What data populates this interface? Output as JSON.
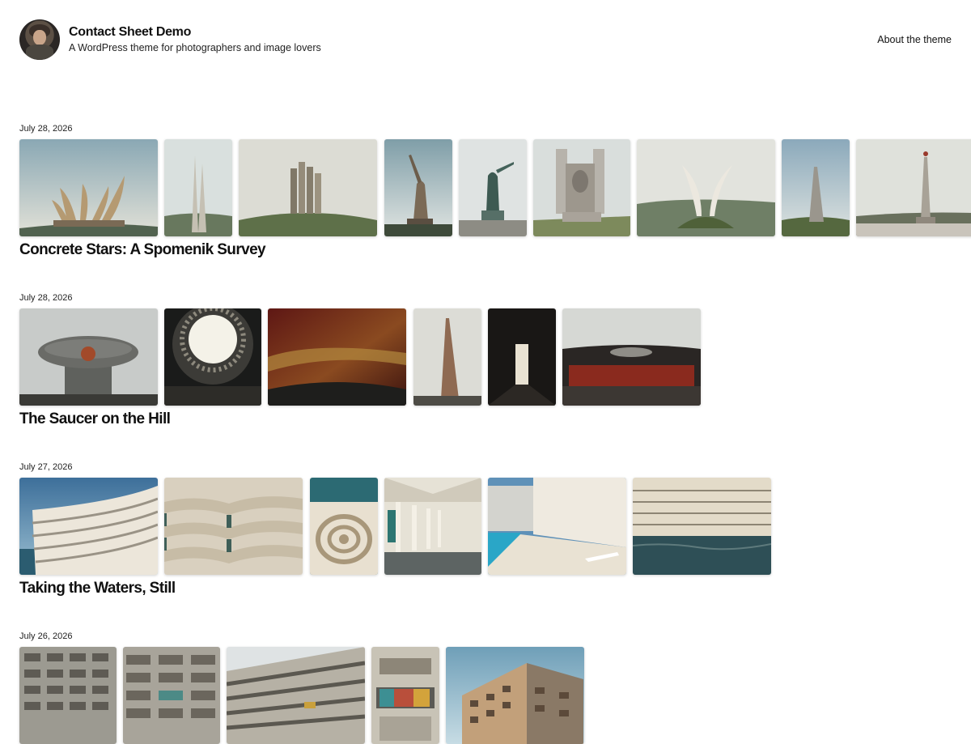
{
  "header": {
    "site_title": "Contact Sheet Demo",
    "tagline": "A WordPress theme for photographers and image lovers",
    "nav": {
      "about_label": "About the theme"
    }
  },
  "posts": [
    {
      "date": "July 28, 2026",
      "title": "Concrete Stars: A Spomenik Survey",
      "photos": [
        "petal-monument-photo",
        "twin-spire-monument-photo",
        "pillar-cluster-monument-photo",
        "sword-statue-photo",
        "soldier-statue-photo",
        "stone-face-monument-photo",
        "horn-monument-photo",
        "needle-spire-photo",
        "obelisk-star-photo"
      ]
    },
    {
      "date": "July 28, 2026",
      "title": "The Saucer on the Hill",
      "photos": [
        "saucer-exterior-photo",
        "dome-oculus-photo",
        "mosaic-ceiling-photo",
        "tower-spike-photo",
        "dark-corridor-photo",
        "ring-hall-mural-photo"
      ]
    },
    {
      "date": "July 27, 2026",
      "title": "Taking the Waters, Still",
      "photos": [
        "curved-sanatorium-photo",
        "balcony-curves-photo",
        "spiral-stair-photo",
        "colonnade-photo",
        "pool-terrace-photo",
        "seafront-block-photo"
      ]
    },
    {
      "date": "July 26, 2026",
      "title": "",
      "photos": [
        "apartment-facade-photo-1",
        "apartment-facade-photo-2",
        "apartment-block-perspective-photo",
        "balcony-carpet-photo",
        "corner-block-photo"
      ]
    }
  ]
}
